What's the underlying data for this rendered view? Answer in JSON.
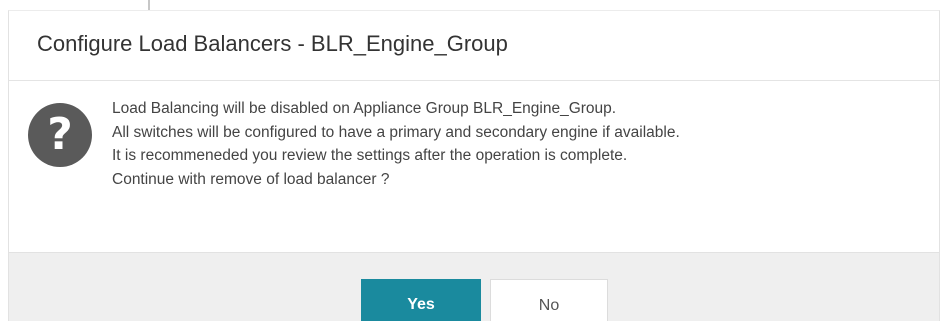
{
  "dialog": {
    "title": "Configure Load Balancers - BLR_Engine_Group",
    "icon": "question-circle-icon",
    "message_lines": [
      "Load Balancing will be disabled on Appliance Group BLR_Engine_Group.",
      "All switches will be configured to have a primary and secondary engine if available.",
      "It is recommeneded you review the settings after the operation is complete.",
      "Continue with remove of load balancer ?"
    ],
    "buttons": {
      "yes_label": "Yes",
      "no_label": "No"
    }
  },
  "colors": {
    "primary_button": "#1a8a9e",
    "icon": "#5a5a5a",
    "footer_background": "#efefef"
  }
}
